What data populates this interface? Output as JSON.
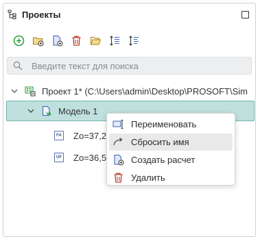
{
  "panel": {
    "title": "Проекты",
    "tree_icon": "tree-structure-icon",
    "restore_icon": "restore-window-icon"
  },
  "toolbar": {
    "items": [
      {
        "name": "add-button",
        "icon": "plus-circle-icon",
        "color": "#2e9b3e"
      },
      {
        "name": "add-folder-button",
        "icon": "folder-plus-icon",
        "color": "#c9a227"
      },
      {
        "name": "add-file-button",
        "icon": "file-plus-icon",
        "color": "#3b5fb5"
      },
      {
        "name": "delete-button",
        "icon": "trash-icon",
        "color": "#c0392b"
      },
      {
        "name": "open-folder-button",
        "icon": "folder-open-icon",
        "color": "#c9a227"
      },
      {
        "name": "sort-ascending-button",
        "icon": "sort-asc-icon",
        "color": "#3b5fb5"
      },
      {
        "name": "sort-descending-button",
        "icon": "sort-desc-icon",
        "color": "#3b5fb5"
      }
    ]
  },
  "search": {
    "placeholder": "Введите текст для поиска",
    "value": ""
  },
  "tree": {
    "project_label": "Проект 1* (C:\\Users\\admin\\Desktop\\PROSOFT\\Sim",
    "model_label": "Модель 1",
    "param_fa_badge": "FA",
    "param_fa_label": "Zo=37,2",
    "param_uf_badge": "UF",
    "param_uf_label": "Zo=36,5"
  },
  "context_menu": {
    "items": [
      {
        "label": "Переименовать",
        "icon": "rename-icon"
      },
      {
        "label": "Сбросить имя",
        "icon": "reset-arrow-icon"
      },
      {
        "label": "Создать расчет",
        "icon": "new-calculation-icon"
      },
      {
        "label": "Удалить",
        "icon": "trash-icon"
      }
    ]
  },
  "colors": {
    "selection_bg": "#bfe0dd",
    "selection_border": "#6fb4ae",
    "accent_green": "#2e9b3e",
    "accent_red": "#c0392b",
    "accent_blue": "#3b5fb5"
  }
}
